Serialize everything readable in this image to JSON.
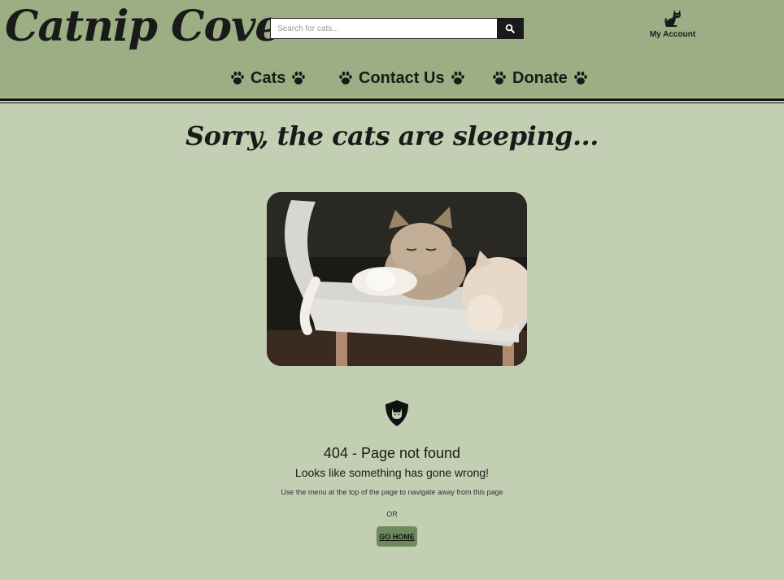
{
  "site": {
    "brand": "Catnip Cove"
  },
  "search": {
    "placeholder": "Search for cats..."
  },
  "account": {
    "label": "My Account",
    "icon": "cat-icon"
  },
  "nav": {
    "items": [
      {
        "label": "Cats",
        "icon": "paw-icon"
      },
      {
        "label": "Contact Us",
        "icon": "paw-icon"
      },
      {
        "label": "Donate",
        "icon": "paw-icon"
      }
    ]
  },
  "main": {
    "headline": "Sorry, the cats are sleeping...",
    "image_alt": "Three cats sleeping on a cat bed",
    "badge_icon": "cat-shield-icon",
    "error_title": "404 - Page not found",
    "error_subtitle": "Looks like something has gone wrong!",
    "error_hint": "Use the menu at the top of the page to navigate away from this page",
    "or_text": "OR",
    "go_home_label": "GO HOME"
  },
  "colors": {
    "header_bg": "#9caf84",
    "page_bg": "#c2cfb2",
    "button_bg": "#6f8a5a",
    "text": "#1a1a1a"
  }
}
